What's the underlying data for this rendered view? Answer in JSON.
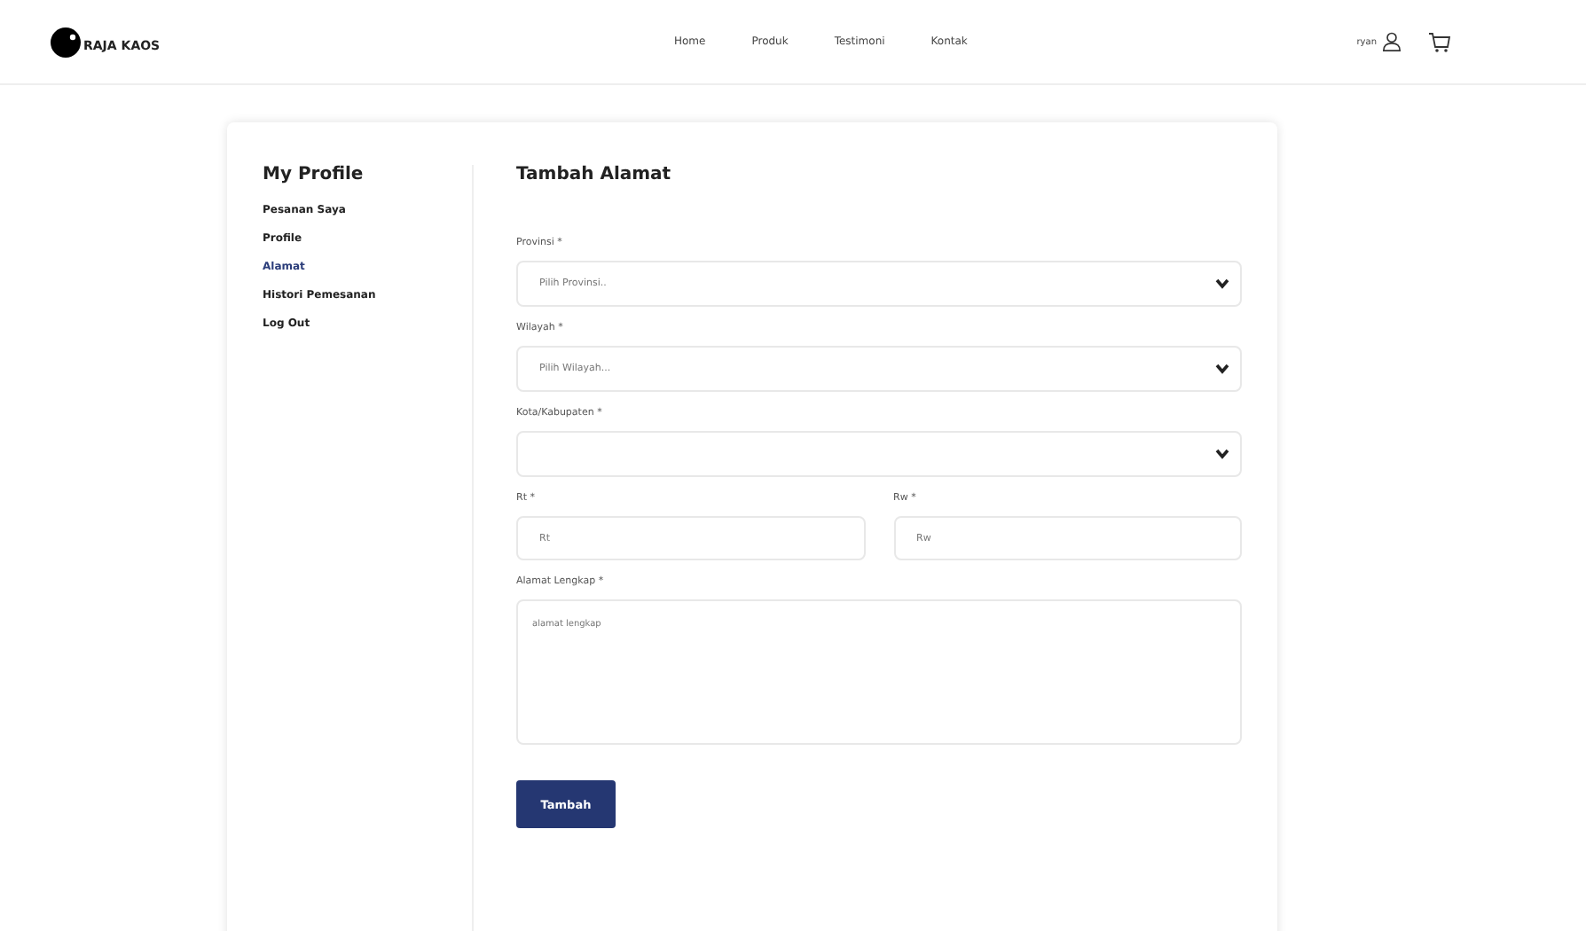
{
  "brand": {
    "name": "RAJA KAOS"
  },
  "nav": [
    "Home",
    "Produk",
    "Testimoni",
    "Kontak"
  ],
  "user": {
    "name": "ryan"
  },
  "sidebar": {
    "title": "My Profile",
    "items": [
      {
        "label": "Pesanan Saya",
        "selected": false
      },
      {
        "label": "Profile",
        "selected": false
      },
      {
        "label": "Alamat",
        "selected": true
      },
      {
        "label": "Histori Pemesanan",
        "selected": false
      },
      {
        "label": "Log Out",
        "selected": false
      }
    ]
  },
  "form": {
    "title": "Tambah Alamat",
    "fields": [
      {
        "kind": "select",
        "label": "Provinsi *",
        "placeholder": "Pilih Provinsi.."
      },
      {
        "kind": "select",
        "label": "Wilayah *",
        "placeholder": "Pilih Wilayah..."
      },
      {
        "kind": "select",
        "label": "Kota/Kabupaten *"
      },
      {
        "kind": "text",
        "label": "Rt *",
        "placeholder": "Rt"
      },
      {
        "kind": "text",
        "label": "Rw *",
        "placeholder": "Rw"
      },
      {
        "kind": "textarea",
        "label": "Alamat Lengkap *",
        "placeholder": "alamat lengkap"
      }
    ],
    "submit": "Tambah"
  }
}
